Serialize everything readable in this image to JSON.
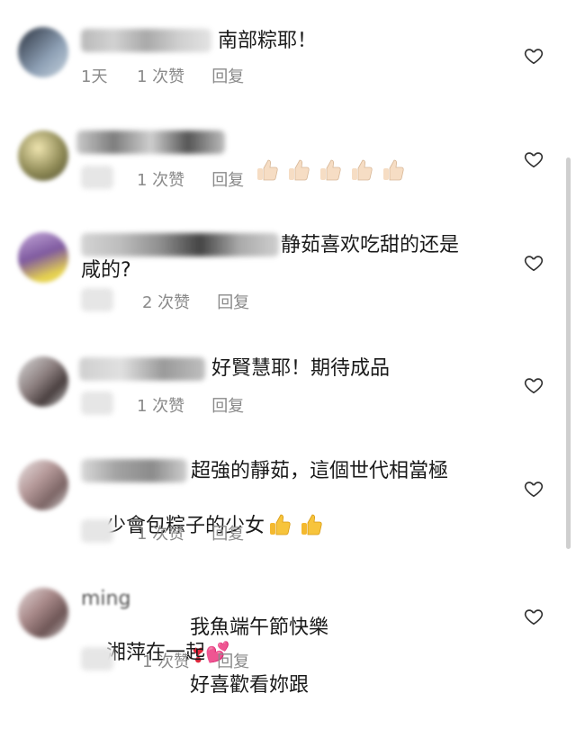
{
  "comments": [
    {
      "text": "南部粽耶！",
      "time": "1天",
      "likes": "1 次赞",
      "reply": "回复"
    },
    {
      "text": "",
      "likes": "1 次赞",
      "reply": "回复"
    },
    {
      "text_line1": "静茹喜欢吃甜的还是",
      "text_line2": "咸的?",
      "likes": "2 次赞",
      "reply": "回复"
    },
    {
      "text": "好賢慧耶！期待成品",
      "likes": "1 次赞",
      "reply": "回复"
    },
    {
      "text_line1": "超強的靜茹，這個世代相當極",
      "text_line2": "少會包粽子的少女",
      "likes": "1 次赞",
      "reply": "回复"
    },
    {
      "name_fragment": "ming",
      "text_line1a": "我魚端午節快樂",
      "text_line1b": "好喜歡看妳跟",
      "text_line2": "湘萍在一起",
      "likes": "1 次赞",
      "reply": "回复"
    }
  ],
  "icons": {
    "heart": "heart-outline-icon",
    "thumbs_up": "thumbs-up-emoji",
    "exclamation": "red-exclamation-emoji",
    "pink_hearts": "two-hearts-emoji"
  },
  "colors": {
    "accent": "#e0283c",
    "meta": "#8a8a8a"
  }
}
